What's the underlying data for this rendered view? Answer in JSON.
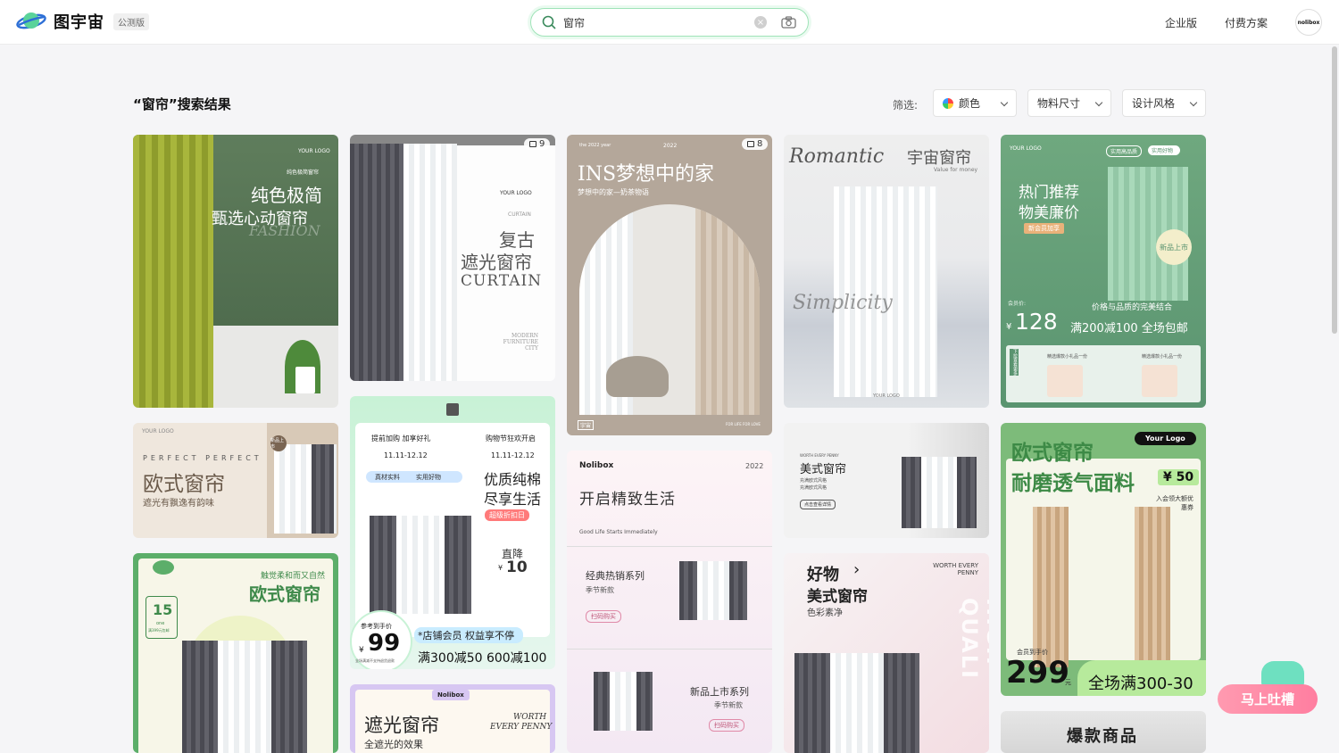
{
  "header": {
    "brand": "图宇宙",
    "beta": "公测版",
    "search_value": "窗帘",
    "nav": [
      "企业版",
      "付费方案"
    ],
    "avatar_text": "nolibox"
  },
  "results": {
    "title": "“窗帘”搜索结果",
    "filter_label": "筛选:",
    "filters": [
      "颜色",
      "物料尺寸",
      "设计风格"
    ]
  },
  "cards": {
    "c1": {
      "line1": "纯色极简",
      "line2": "甄选心动窗帘",
      "deco": "FASHION",
      "logo": "YOUR LOGO",
      "small": "纯色极简窗帘"
    },
    "c2": {
      "count": "9",
      "logo": "YOUR LOGO",
      "label": "CURTAIN",
      "line1": "复古",
      "line2": "遮光窗帘",
      "line3": "CURTAIN",
      "foot": "MODERN FURNITURE CITY"
    },
    "c3": {
      "count": "8",
      "top_left": "the 2022 year",
      "top_mid": "2022",
      "title": "INS梦想中的家",
      "sub": "梦想中的家—奶茶物语",
      "tag": "宇宙",
      "foot": "FOR LIFE FOR LOVE"
    },
    "c4": {
      "script1": "Romantic",
      "title": "宇宙窗帘",
      "sub": "Value for money",
      "script2": "Simplicity",
      "logo": "YOUR LOGO"
    },
    "c5": {
      "logo": "YOUR LOGO",
      "tag1": "实用高品质",
      "tag2": "实用好物",
      "line1": "热门推荐",
      "line2": "物美廉价",
      "member": "新会员加享",
      "badge": "新品上市",
      "price_label": "会员价:",
      "slogan": "价格与品质的完美结合",
      "price": "128",
      "currency": "¥",
      "promo": "满200减100 全场包邮",
      "side": "下拉查看更多",
      "item1": "精选爆款小礼品一份",
      "item2": "精选爆款小礼品一份"
    },
    "c6": {
      "logo": "YOUR LOGO",
      "eng": "PERFECT  PERFECT",
      "title": "欧式窗帘",
      "sub": "遮光有飘逸有韵味",
      "badge": "新品上市"
    },
    "c7": {
      "top1": "提前加购 加享好礼",
      "top2": "购物节狂欢开启",
      "date1": "11.11-12.12",
      "date2": "11.11-12.12",
      "tab1": "真材实料",
      "tab2": "实用好物",
      "title1": "优质纯棉",
      "title2": "尽享生活",
      "discount": "超级折扣日",
      "drop": "直降",
      "drop_val": "10",
      "currency": "¥",
      "ref": "参考到手价",
      "price": "99",
      "fine": "全场满减不支持退货退款",
      "member": "*店铺会员 权益享不停",
      "promo": "满300减50 600减100"
    },
    "c8": {
      "brand": "Nolibox",
      "year": "2022",
      "title": "开启精致生活",
      "sub": "Good Life Starts Immediately",
      "s1": "经典热销系列",
      "s1b": "季节新款",
      "s1c": "扫码购买",
      "s2": "新品上市系列",
      "s2b": "季节新款",
      "s2c": "扫码购买"
    },
    "c9": {
      "eng": "WORTH EVERY PENNY",
      "title": "美式窗帘",
      "sub1": "充满欧式风格",
      "sub2": "充满欧式风格",
      "btn": "点击查看详情"
    },
    "c10": {
      "line1": "好物",
      "line2": "美式窗帘",
      "sub": "色彩素净",
      "eng": "WORTH EVERY PENNY",
      "vert": "HIGH QUALI"
    },
    "c11": {
      "logo": "Your Logo",
      "line1": "欧式窗帘",
      "line2": "耐磨透气面料",
      "price_top": "¥ 50",
      "coupon": "入会领大额优惠券",
      "ref": "会员到手价",
      "price": "299",
      "unit": "元",
      "promo": "全场满300-30"
    },
    "c12": {
      "title": "爆款商品"
    },
    "c13": {
      "small": "触觉柔和而又自然",
      "title": "欧式窗帘",
      "day": "15",
      "month": "one",
      "note": "满399元包邮"
    },
    "c14": {
      "brand": "Nolibox",
      "title": "遮光窗帘",
      "eng1": "WORTH",
      "eng2": "EVERY PENNY",
      "sub": "全遮光的效果"
    }
  },
  "feedback": {
    "label": "马上吐槽"
  }
}
